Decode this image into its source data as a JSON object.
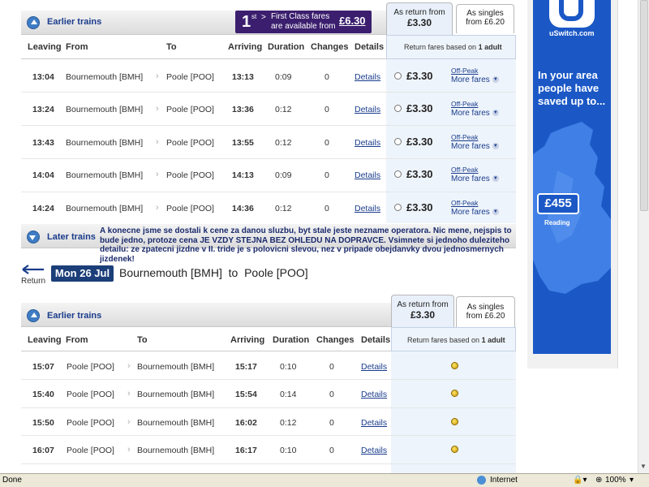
{
  "outbound": {
    "earlier_trains": "Earlier trains",
    "later_trains": "Later trains",
    "promo": {
      "number": "1",
      "sup": "st",
      "line1": "First Class fares",
      "line2": "are available from",
      "price": "£6.30"
    },
    "tab_return": {
      "label": "As return from",
      "price": "£3.30"
    },
    "tab_singles": {
      "label": "As singles",
      "price_line": "from £6.20"
    },
    "fare_basis": {
      "prefix": "Return fares based on ",
      "strong": "1 adult"
    },
    "headers": {
      "leaving": "Leaving",
      "from": "From",
      "to": "To",
      "arriving": "Arriving",
      "duration": "Duration",
      "changes": "Changes",
      "details": "Details"
    },
    "rows": [
      {
        "leaving": "13:04",
        "from": "Bournemouth [BMH]",
        "to": "Poole [POO]",
        "arriving": "13:13",
        "duration": "0:09",
        "changes": "0",
        "details": "Details",
        "price": "£3.30",
        "ticket": "Off-Peak",
        "more": "More fares"
      },
      {
        "leaving": "13:24",
        "from": "Bournemouth [BMH]",
        "to": "Poole [POO]",
        "arriving": "13:36",
        "duration": "0:12",
        "changes": "0",
        "details": "Details",
        "price": "£3.30",
        "ticket": "Off-Peak",
        "more": "More fares"
      },
      {
        "leaving": "13:43",
        "from": "Bournemouth [BMH]",
        "to": "Poole [POO]",
        "arriving": "13:55",
        "duration": "0:12",
        "changes": "0",
        "details": "Details",
        "price": "£3.30",
        "ticket": "Off-Peak",
        "more": "More fares"
      },
      {
        "leaving": "14:04",
        "from": "Bournemouth [BMH]",
        "to": "Poole [POO]",
        "arriving": "14:13",
        "duration": "0:09",
        "changes": "0",
        "details": "Details",
        "price": "£3.30",
        "ticket": "Off-Peak",
        "more": "More fares"
      },
      {
        "leaving": "14:24",
        "from": "Bournemouth [BMH]",
        "to": "Poole [POO]",
        "arriving": "14:36",
        "duration": "0:12",
        "changes": "0",
        "details": "Details",
        "price": "£3.30",
        "ticket": "Off-Peak",
        "more": "More fares"
      }
    ]
  },
  "annotation": "A konecne jsme se dostali k cene za danou sluzbu, byt stale jeste nezname operatora. Nic mene, nejspis to bude jedno, protoze cena JE VZDY STEJNA BEZ OHLEDU NA DOPRAVCE. Vsimnete si jednoho duleziteho detailu: ze zpatecni jizdne v II. tride je s polovicni slevou, nez v pripade obejdanvky dvou jednosmernych jizdenek!",
  "return_journey": {
    "label": "Return",
    "date": "Mon 26 Jul",
    "route": "Bournemouth [BMH]  to  Poole [POO]",
    "earlier_trains": "Earlier trains",
    "tab_return": {
      "label": "As return from",
      "price": "£3.30"
    },
    "tab_singles": {
      "label": "As singles",
      "price_line": "from £6.20"
    },
    "fare_basis": {
      "prefix": "Return fares based on ",
      "strong": "1 adult"
    },
    "headers": {
      "leaving": "Leaving",
      "from": "From",
      "to": "To",
      "arriving": "Arriving",
      "duration": "Duration",
      "changes": "Changes",
      "details": "Details"
    },
    "rows": [
      {
        "leaving": "15:07",
        "from": "Poole [POO]",
        "to": "Bournemouth [BMH]",
        "arriving": "15:17",
        "duration": "0:10",
        "changes": "0",
        "details": "Details"
      },
      {
        "leaving": "15:40",
        "from": "Poole [POO]",
        "to": "Bournemouth [BMH]",
        "arriving": "15:54",
        "duration": "0:14",
        "changes": "0",
        "details": "Details"
      },
      {
        "leaving": "15:50",
        "from": "Poole [POO]",
        "to": "Bournemouth [BMH]",
        "arriving": "16:02",
        "duration": "0:12",
        "changes": "0",
        "details": "Details"
      },
      {
        "leaving": "16:07",
        "from": "Poole [POO]",
        "to": "Bournemouth [BMH]",
        "arriving": "16:17",
        "duration": "0:10",
        "changes": "0",
        "details": "Details"
      }
    ]
  },
  "ad": {
    "brand": "uSwitch.com",
    "headline": "In your area people have saved up to...",
    "amount": "£455",
    "place": "Reading",
    "colors": {
      "bg": "#1b58c6",
      "accent": "#ffffff"
    }
  },
  "statusbar": {
    "left": "Done",
    "zone": "Internet",
    "zoom": "100%"
  }
}
